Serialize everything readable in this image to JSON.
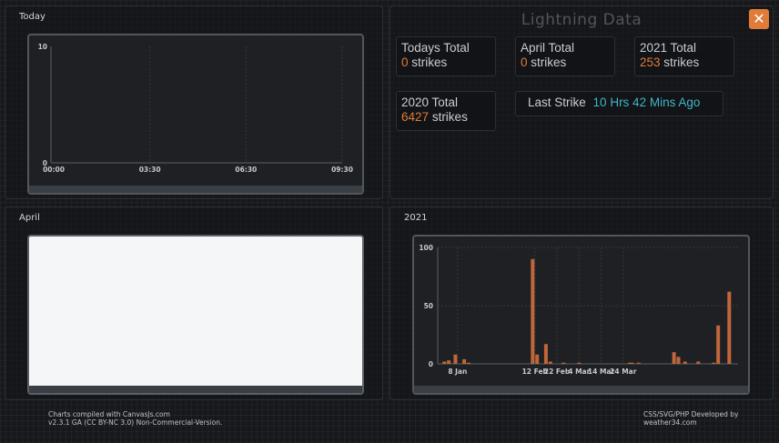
{
  "panels": {
    "today": {
      "title": "Today"
    },
    "april": {
      "title": "April"
    },
    "year2021": {
      "title": "2021"
    }
  },
  "lightning": {
    "title": "Lightning Data",
    "close_icon": "close-icon",
    "todays_total": {
      "label": "Todays Total",
      "value": "0",
      "unit": "strikes"
    },
    "april_total": {
      "label": "April Total",
      "value": "0",
      "unit": "strikes"
    },
    "year2021_total": {
      "label": "2021 Total",
      "value": "253",
      "unit": "strikes"
    },
    "year2020_total": {
      "label": "2020 Total",
      "value": "6427",
      "unit": "strikes"
    },
    "last_strike": {
      "label": "Last Strike",
      "value": "10 Hrs 42 Mins Ago"
    },
    "colors": {
      "accent": "#e07b39",
      "highlight": "#3fb7c7"
    }
  },
  "chart_data": [
    {
      "type": "line",
      "x_ticks": [
        "00:00",
        "03:30",
        "06:30",
        "09:30"
      ],
      "y_ticks": [
        "0",
        "10"
      ],
      "ylim": [
        0,
        10
      ],
      "series": []
    },
    {
      "type": "bar",
      "x_ticks": [
        "8 Jan",
        "12 Feb",
        "22 Feb",
        "4 Mar",
        "14 Mar",
        "24 Mar"
      ],
      "y_ticks": [
        "0",
        "50",
        "100"
      ],
      "ylim": [
        0,
        100
      ],
      "bar_color": "#c0663a",
      "bars": [
        {
          "day": 1,
          "value": 2
        },
        {
          "day": 3,
          "value": 3
        },
        {
          "day": 6,
          "value": 8
        },
        {
          "day": 10,
          "value": 4
        },
        {
          "day": 12,
          "value": 1
        },
        {
          "day": 41,
          "value": 90
        },
        {
          "day": 43,
          "value": 8
        },
        {
          "day": 47,
          "value": 17
        },
        {
          "day": 49,
          "value": 2
        },
        {
          "day": 55,
          "value": 1
        },
        {
          "day": 62,
          "value": 1
        },
        {
          "day": 85,
          "value": 1
        },
        {
          "day": 86,
          "value": 1
        },
        {
          "day": 89,
          "value": 1
        },
        {
          "day": 105,
          "value": 10
        },
        {
          "day": 107,
          "value": 6
        },
        {
          "day": 110,
          "value": 2
        },
        {
          "day": 116,
          "value": 2
        },
        {
          "day": 123,
          "value": 1
        },
        {
          "day": 125,
          "value": 33
        },
        {
          "day": 130,
          "value": 62
        }
      ],
      "x_range_days": [
        -2,
        134
      ],
      "tick_days": [
        7,
        42,
        52,
        62,
        72,
        82
      ]
    }
  ],
  "footer": {
    "left_line1": "Charts compiled with CanvasJs.com",
    "left_line2": "v2.3.1 GA (CC BY-NC 3.0) Non-Commercial-Version.",
    "right_line1": "CSS/SVG/PHP Developed by",
    "right_line2": "weather34.com"
  }
}
